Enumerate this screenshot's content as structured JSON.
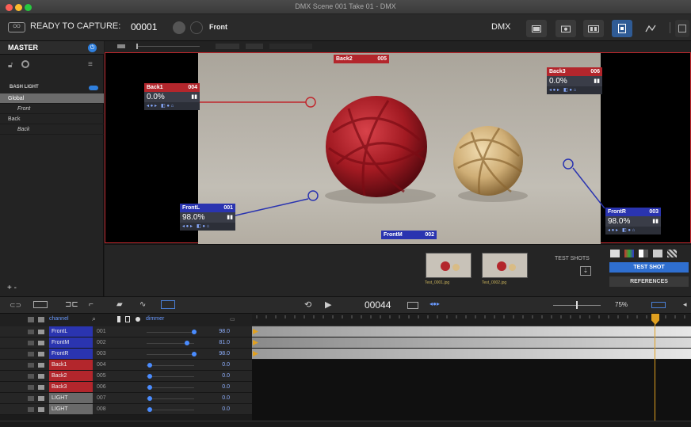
{
  "window": {
    "title": "DMX  Scene 001  Take 01 - DMX"
  },
  "toolbar": {
    "status": "READY TO CAPTURE:",
    "take_number": "00001",
    "camera_name": "Front",
    "mode_label": "DMX"
  },
  "left_panel": {
    "master_label": "MASTER",
    "group_label": "BASH LIGHT",
    "items": [
      {
        "label": "Global",
        "selected": true
      },
      {
        "label": "Front",
        "child": true
      },
      {
        "label": "Back",
        "child": false
      },
      {
        "label": "Back",
        "child": true
      }
    ],
    "footer": "+ -"
  },
  "lights": [
    {
      "name": "Back1",
      "num": "004",
      "value": "0.0%",
      "color": "#b3262c"
    },
    {
      "name": "Back2",
      "num": "005",
      "color": "#b3262c"
    },
    {
      "name": "Back3",
      "num": "006",
      "value": "0.0%",
      "color": "#b3262c"
    },
    {
      "name": "FrontL",
      "num": "001",
      "value": "98.0%",
      "color": "#2a34b0"
    },
    {
      "name": "FrontM",
      "num": "002",
      "color": "#2a34b0"
    },
    {
      "name": "FrontR",
      "num": "003",
      "value": "98.0%",
      "color": "#2a34b0"
    }
  ],
  "test_shots": {
    "label": "TEST SHOTS",
    "files": [
      "Test_0001.jpg",
      "Test_0002.jpg"
    ],
    "test_shot_button": "TEST SHOT",
    "references_button": "REFERENCES"
  },
  "timeline": {
    "frame": "00044",
    "zoom": "75%"
  },
  "channel_header": {
    "channel": "channel",
    "dimmer": "dimmer"
  },
  "channels": [
    {
      "name": "FrontL",
      "num": "001",
      "value": "98.0",
      "color": "#2a34b0"
    },
    {
      "name": "FrontM",
      "num": "002",
      "value": "81.0",
      "color": "#2a34b0"
    },
    {
      "name": "FrontR",
      "num": "003",
      "value": "98.0",
      "color": "#2a34b0"
    },
    {
      "name": "Back1",
      "num": "004",
      "value": "0.0",
      "color": "#b3262c"
    },
    {
      "name": "Back2",
      "num": "005",
      "value": "0.0",
      "color": "#b3262c"
    },
    {
      "name": "Back3",
      "num": "006",
      "value": "0.0",
      "color": "#b3262c"
    },
    {
      "name": "LIGHT",
      "num": "007",
      "value": "0.0",
      "color": "#6a6a6a"
    },
    {
      "name": "LIGHT",
      "num": "008",
      "value": "0.0",
      "color": "#6a6a6a"
    }
  ],
  "colors": {
    "accent": "#2f5b95",
    "red": "#b3262c",
    "blue": "#2a34b0",
    "playhead": "#e0a020"
  }
}
